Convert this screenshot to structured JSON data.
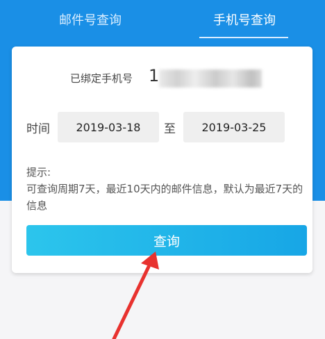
{
  "tabs": [
    {
      "label": "邮件号查询",
      "active": false
    },
    {
      "label": "手机号查询",
      "active": true
    }
  ],
  "card": {
    "bound_label": "已绑定手机号",
    "bound_number_visible": "1",
    "time_label": "时间",
    "start_date": "2019-03-18",
    "to_label": "至",
    "end_date": "2019-03-25",
    "tip_title": "提示:",
    "tip_body": "可查询周期7天，最近10天内的邮件信息，默认为最近7天的信息",
    "query_button": "查询"
  },
  "colors": {
    "header": "#1a8fe6",
    "button_start": "#2cc5ec",
    "button_end": "#17a6e6",
    "arrow": "#e8322f"
  }
}
